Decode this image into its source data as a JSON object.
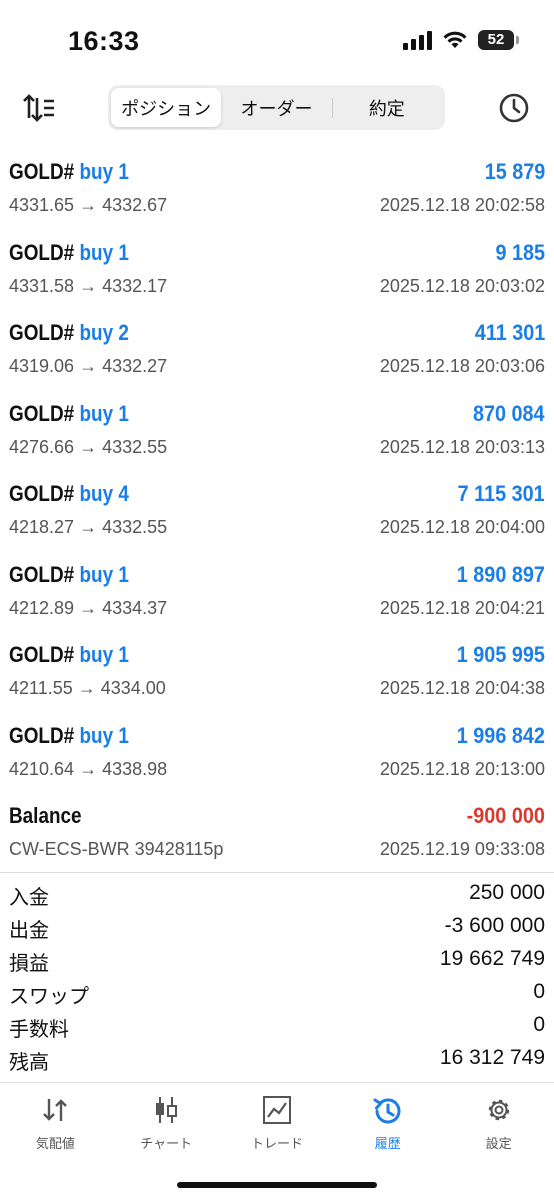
{
  "status_bar": {
    "time": "16:33",
    "battery": "52"
  },
  "segments": [
    "ポジション",
    "オーダー",
    "約定"
  ],
  "deals": [
    {
      "symbol": "GOLD#",
      "side": "buy 1",
      "profit": "15 879",
      "prices": "4331.65 → 4332.67",
      "time": "2025.12.18 20:02:58"
    },
    {
      "symbol": "GOLD#",
      "side": "buy 1",
      "profit": "9 185",
      "prices": "4331.58 → 4332.17",
      "time": "2025.12.18 20:03:02"
    },
    {
      "symbol": "GOLD#",
      "side": "buy 2",
      "profit": "411 301",
      "prices": "4319.06 → 4332.27",
      "time": "2025.12.18 20:03:06"
    },
    {
      "symbol": "GOLD#",
      "side": "buy 1",
      "profit": "870 084",
      "prices": "4276.66 → 4332.55",
      "time": "2025.12.18 20:03:13"
    },
    {
      "symbol": "GOLD#",
      "side": "buy 4",
      "profit": "7 115 301",
      "prices": "4218.27 → 4332.55",
      "time": "2025.12.18 20:04:00"
    },
    {
      "symbol": "GOLD#",
      "side": "buy 1",
      "profit": "1 890 897",
      "prices": "4212.89 → 4334.37",
      "time": "2025.12.18 20:04:21"
    },
    {
      "symbol": "GOLD#",
      "side": "buy 1",
      "profit": "1 905 995",
      "prices": "4211.55 → 4334.00",
      "time": "2025.12.18 20:04:38"
    },
    {
      "symbol": "GOLD#",
      "side": "buy 1",
      "profit": "1 996 842",
      "prices": "4210.64 → 4338.98",
      "time": "2025.12.18 20:13:00"
    },
    {
      "symbol": "Balance",
      "side": "",
      "profit": "-900 000",
      "prices": "CW-ECS-BWR 39428115p",
      "time": "2025.12.19 09:33:08"
    }
  ],
  "summary": [
    {
      "label": "入金",
      "value": "250 000"
    },
    {
      "label": "出金",
      "value": "-3 600 000"
    },
    {
      "label": "損益",
      "value": "19 662 749"
    },
    {
      "label": "スワップ",
      "value": "0"
    },
    {
      "label": "手数料",
      "value": "0"
    },
    {
      "label": "残高",
      "value": "16 312 749"
    }
  ],
  "tabs": [
    {
      "label": "気配値",
      "icon": "quotes-arrows-icon"
    },
    {
      "label": "チャート",
      "icon": "candlestick-icon"
    },
    {
      "label": "トレード",
      "icon": "trade-chart-icon"
    },
    {
      "label": "履歴",
      "icon": "history-clock-icon",
      "active": true
    },
    {
      "label": "設定",
      "icon": "gear-icon"
    }
  ],
  "colors": {
    "accent": "#1a7ee6",
    "negative": "#d83a2f"
  }
}
